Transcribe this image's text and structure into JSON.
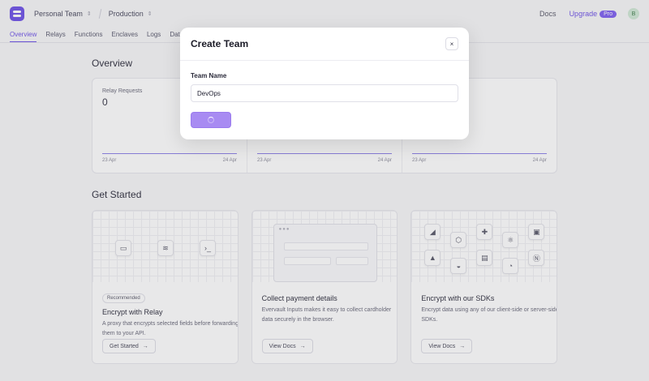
{
  "header": {
    "team": "Personal Team",
    "app": "Production",
    "docs": "Docs",
    "upgrade": "Upgrade",
    "pro_badge": "Pro",
    "avatar_initial": "B"
  },
  "tabs": [
    {
      "label": "Overview",
      "active": true
    },
    {
      "label": "Relays"
    },
    {
      "label": "Functions"
    },
    {
      "label": "Enclaves"
    },
    {
      "label": "Logs"
    },
    {
      "label": "Data"
    }
  ],
  "overview": {
    "title": "Overview",
    "stats": [
      {
        "label": "Relay Requests",
        "value": "0",
        "date_start": "23 Apr",
        "date_end": "24 Apr"
      },
      {
        "label": "",
        "value": "",
        "date_start": "23 Apr",
        "date_end": "24 Apr"
      },
      {
        "label": "",
        "value": "",
        "date_start": "23 Apr",
        "date_end": "24 Apr"
      }
    ]
  },
  "get_started": {
    "title": "Get Started",
    "cards": [
      {
        "badge": "Recommended",
        "title": "Encrypt with Relay",
        "desc": "A proxy that encrypts selected fields before forwarding them to your API.",
        "button": "Get Started"
      },
      {
        "title": "Collect payment details",
        "desc": "Evervault Inputs makes it easy to collect cardholder data securely in the browser.",
        "button": "View Docs"
      },
      {
        "title": "Encrypt with our SDKs",
        "desc": "Encrypt data using any of our client-side or server-side SDKs.",
        "button": "View Docs"
      }
    ]
  },
  "modal": {
    "title": "Create Team",
    "close": "×",
    "field_label": "Team Name",
    "field_value": "DevOps"
  },
  "colors": {
    "accent": "#6b4ee6",
    "button_loading": "#a88bf2"
  }
}
